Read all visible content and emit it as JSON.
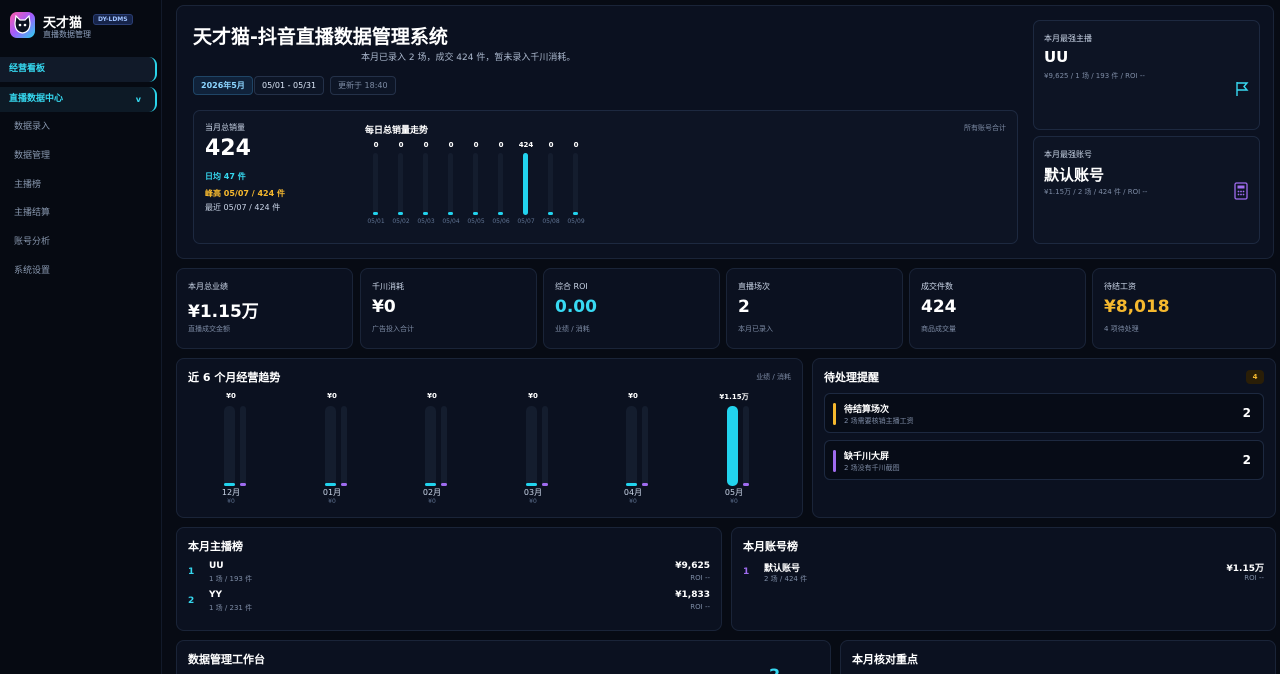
{
  "brand": {
    "name": "天才猫",
    "tag": "DY-LDMS",
    "subtitle": "直播数据管理"
  },
  "sidebar": {
    "dashboard": "经营看板",
    "group": "直播数据中心",
    "group_caret": "v",
    "items": [
      "数据录入",
      "数据管理",
      "主播榜",
      "主播结算",
      "账号分析",
      "系统设置"
    ]
  },
  "hero": {
    "title": "天才猫-抖音直播数据管理系统",
    "subtitle": "本月已录入 2 场，成交 424 件，暂未录入千川消耗。",
    "chips": [
      "2026年5月",
      "05/01 - 05/31",
      "更新于 18:40"
    ],
    "sales": {
      "label": "当月总销量",
      "value": "424",
      "daily_avg": "日均 47 件",
      "peak": "峰高 05/07 / 424 件",
      "latest": "最近 05/07 / 424 件"
    },
    "daily_trend": {
      "title": "每日总销量走势",
      "note": "所有账号合计"
    }
  },
  "chart_data": [
    {
      "type": "bar",
      "title": "每日总销量走势",
      "categories": [
        "05/01",
        "05/02",
        "05/03",
        "05/04",
        "05/05",
        "05/06",
        "05/07",
        "05/08",
        "05/09"
      ],
      "values": [
        0,
        0,
        0,
        0,
        0,
        0,
        424,
        0,
        0
      ],
      "value_labels": [
        "0",
        "0",
        "0",
        "0",
        "0",
        "0",
        "424",
        "0",
        "0"
      ]
    },
    {
      "type": "bar",
      "title": "近 6 个月经营趋势",
      "legend": "业绩 / 消耗",
      "categories": [
        "12月",
        "01月",
        "02月",
        "03月",
        "04月",
        "05月"
      ],
      "series": [
        {
          "name": "业绩",
          "values": [
            0,
            0,
            0,
            0,
            0,
            11500
          ]
        },
        {
          "name": "消耗",
          "values": [
            0,
            0,
            0,
            0,
            0,
            0
          ]
        }
      ],
      "value_labels": [
        "¥0",
        "¥0",
        "¥0",
        "¥0",
        "¥0",
        "¥1.15万"
      ],
      "sub_labels": [
        "¥0",
        "¥0",
        "¥0",
        "¥0",
        "¥0",
        "¥0"
      ]
    }
  ],
  "top_anchor": {
    "label": "本月最强主播",
    "name": "UU",
    "detail": "¥9,625 / 1 场 / 193 件 / ROI --"
  },
  "top_account": {
    "label": "本月最强账号",
    "name": "默认账号",
    "detail": "¥1.15万 / 2 场 / 424 件 / ROI --"
  },
  "kpis": [
    {
      "label": "本月总业绩",
      "value": "¥1.15万",
      "sub": "直播成交金额",
      "color": "#ffffff"
    },
    {
      "label": "千川消耗",
      "value": "¥0",
      "sub": "广告投入合计",
      "color": "#ffffff"
    },
    {
      "label": "综合 ROI",
      "value": "0.00",
      "sub": "业绩 / 消耗",
      "color": "#38d9f2"
    },
    {
      "label": "直播场次",
      "value": "2",
      "sub": "本月已录入",
      "color": "#ffffff"
    },
    {
      "label": "成交件数",
      "value": "424",
      "sub": "商品成交量",
      "color": "#ffffff"
    },
    {
      "label": "待结工资",
      "value": "¥8,018",
      "sub": "4 项待处理",
      "color": "#f5b82e"
    }
  ],
  "trend": {
    "title": "近 6 个月经营趋势",
    "legend": "业绩 / 消耗"
  },
  "todos": {
    "title": "待处理提醒",
    "badge": "4",
    "items": [
      {
        "title": "待结算场次",
        "sub": "2 场需要核销主播工资",
        "count": "2",
        "color": "#f5b82e"
      },
      {
        "title": "缺千川大屏",
        "sub": "2 场没有千川截图",
        "count": "2",
        "color": "#a06cf0"
      }
    ]
  },
  "anchor_rank": {
    "title": "本月主播榜",
    "rows": [
      {
        "rank": "1",
        "name": "UU",
        "sub": "1 场 / 193 件",
        "amount": "¥9,625",
        "roi": "ROI --"
      },
      {
        "rank": "2",
        "name": "YY",
        "sub": "1 场 / 231 件",
        "amount": "¥1,833",
        "roi": "ROI --"
      }
    ]
  },
  "account_rank": {
    "title": "本月账号榜",
    "rows": [
      {
        "rank": "1",
        "name": "默认账号",
        "sub": "2 场 / 424 件",
        "amount": "¥1.15万",
        "roi": "ROI --"
      }
    ]
  },
  "workbench": {
    "title": "数据管理工作台",
    "count": "2"
  },
  "focus": {
    "title": "本月核对重点"
  }
}
